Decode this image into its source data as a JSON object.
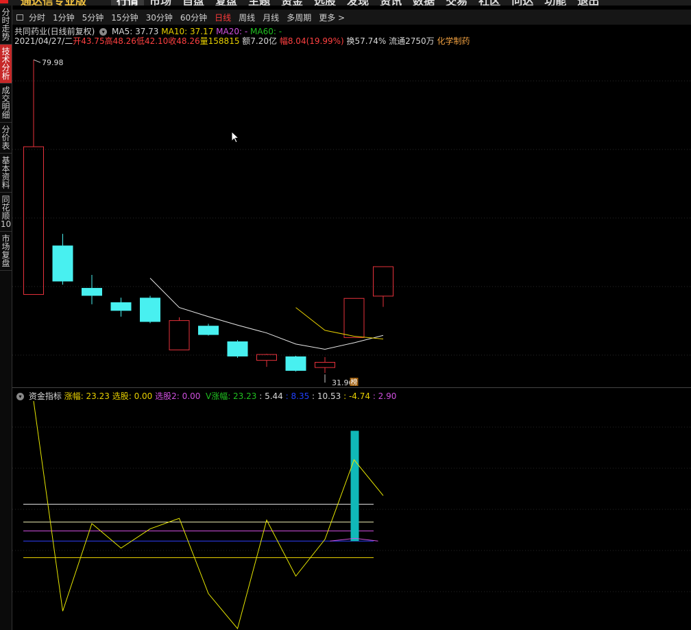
{
  "menu": {
    "brand": "通达信专业版",
    "items": [
      "行情",
      "市场",
      "自盘",
      "复盘",
      "主题",
      "资金",
      "选股",
      "发现",
      "资讯",
      "数据",
      "交易",
      "社区",
      "问达",
      "功能",
      "退出"
    ]
  },
  "left_nav": [
    {
      "label": "分时走势",
      "active": false
    },
    {
      "label": "技术分析",
      "active": true
    },
    {
      "label": "成交明细",
      "active": false
    },
    {
      "label": "分价表",
      "active": false
    },
    {
      "label": "基本资料",
      "active": false
    },
    {
      "label": "同花顺10",
      "active": false
    },
    {
      "label": "市场复盘",
      "active": false
    }
  ],
  "periods": [
    "分时",
    "1分钟",
    "5分钟",
    "15分钟",
    "30分钟",
    "60分钟",
    "日线",
    "周线",
    "月线",
    "多周期",
    "更多 >"
  ],
  "active_period": "日线",
  "stock": {
    "name_line": "共同药业(日线前复权)",
    "ma5": "MA5: 37.73",
    "ma10": "MA10: 37.17",
    "ma20": "MA20: -",
    "ma60": "MA60: -",
    "date": "2021/04/27/二",
    "open": "开43.75",
    "high": "高48.26",
    "low": "低42.10",
    "close": "收48.26",
    "vol": "量158815",
    "amount": "额7.20亿",
    "change": "幅8.04(19.99%)",
    "turnover": "换57.74%",
    "float": "流通2750万",
    "sector": "化学制药",
    "max_label": "79.98",
    "min_label": "31.96",
    "badge": "榜"
  },
  "indicator": {
    "name": "资金指标",
    "zf": "涨幅: 23.23",
    "xg": "选股: 0.00",
    "xg2": "选股2: 0.00",
    "vzf": "V涨幅: 23.23",
    "v1": ": 5.44",
    "v2": ": 8.35",
    "v3": ": 10.53",
    "v4": ": -4.74",
    "v5": ": 2.90"
  },
  "chart_data": {
    "type": "candlestick",
    "price_range": [
      30.5,
      82
    ],
    "candles": [
      {
        "open": 44.0,
        "high": 79.98,
        "low": 44.0,
        "close": 66.65,
        "up": true
      },
      {
        "open": 51.5,
        "high": 53.3,
        "low": 45.5,
        "close": 46.0,
        "up": false
      },
      {
        "open": 45.0,
        "high": 47.0,
        "low": 42.5,
        "close": 43.8,
        "up": false
      },
      {
        "open": 42.8,
        "high": 43.5,
        "low": 40.6,
        "close": 41.5,
        "up": false
      },
      {
        "open": 43.5,
        "high": 43.8,
        "low": 39.6,
        "close": 39.8,
        "up": false
      },
      {
        "open": 35.5,
        "high": 40.5,
        "low": 35.5,
        "close": 40.0,
        "up": true
      },
      {
        "open": 39.2,
        "high": 39.5,
        "low": 37.7,
        "close": 37.8,
        "up": false
      },
      {
        "open": 36.8,
        "high": 37.0,
        "low": 34.3,
        "close": 34.5,
        "up": false
      },
      {
        "open": 33.9,
        "high": 34.9,
        "low": 32.9,
        "close": 34.8,
        "up": true
      },
      {
        "open": 34.5,
        "high": 34.6,
        "low": 32.2,
        "close": 32.3,
        "up": false
      },
      {
        "open": 32.8,
        "high": 34.4,
        "low": 31.96,
        "close": 33.6,
        "up": true
      },
      {
        "open": 37.4,
        "high": 43.4,
        "low": 37.4,
        "close": 43.4,
        "up": true
      },
      {
        "open": 43.75,
        "high": 48.26,
        "low": 42.1,
        "close": 48.26,
        "up": true
      }
    ],
    "ma5": [
      null,
      null,
      null,
      null,
      46.5,
      42.0,
      40.6,
      39.3,
      38.1,
      36.4,
      35.6,
      36.6,
      37.73
    ],
    "ma10": [
      null,
      null,
      null,
      null,
      null,
      null,
      null,
      null,
      null,
      42.0,
      38.5,
      37.6,
      37.17
    ],
    "sub_range": [
      -25,
      40
    ],
    "zf": [
      40,
      -20,
      5,
      -2,
      3.5,
      6.5,
      -15,
      -25,
      6,
      -10,
      0.5,
      23.23,
      13
    ],
    "bar_value": 31.5,
    "bar_index": 11,
    "hlines": [
      {
        "value": 10.53,
        "color": "#e0e0e0"
      },
      {
        "value": 5.44,
        "color": "#e8e8b0"
      },
      {
        "value": 2.9,
        "color": "#d050e0"
      },
      {
        "value": 0.0,
        "color": "#3040ff"
      },
      {
        "value": -4.74,
        "color": "#e8d000"
      }
    ]
  },
  "colors": {
    "up": "#e8323c",
    "down": "#48f0f0",
    "ma5": "#e8e8e8",
    "ma10": "#e8d000",
    "zf": "#e8e800",
    "bar": "#10b8b8"
  }
}
